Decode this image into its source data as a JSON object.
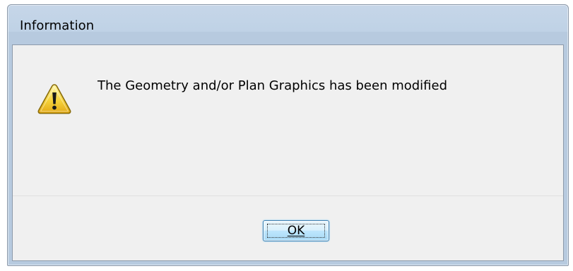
{
  "window": {
    "title": "Information"
  },
  "message": {
    "text": "The Geometry and/or Plan Graphics has been modified",
    "icon": "warning-icon"
  },
  "buttons": {
    "ok_label": "OK",
    "ok_accelerator": "O"
  },
  "colors": {
    "titlebar": "#c6d6e8",
    "client_background": "#f0f0f0",
    "button_border": "#3c7fb1",
    "warning_fill": "#f6d33c"
  }
}
